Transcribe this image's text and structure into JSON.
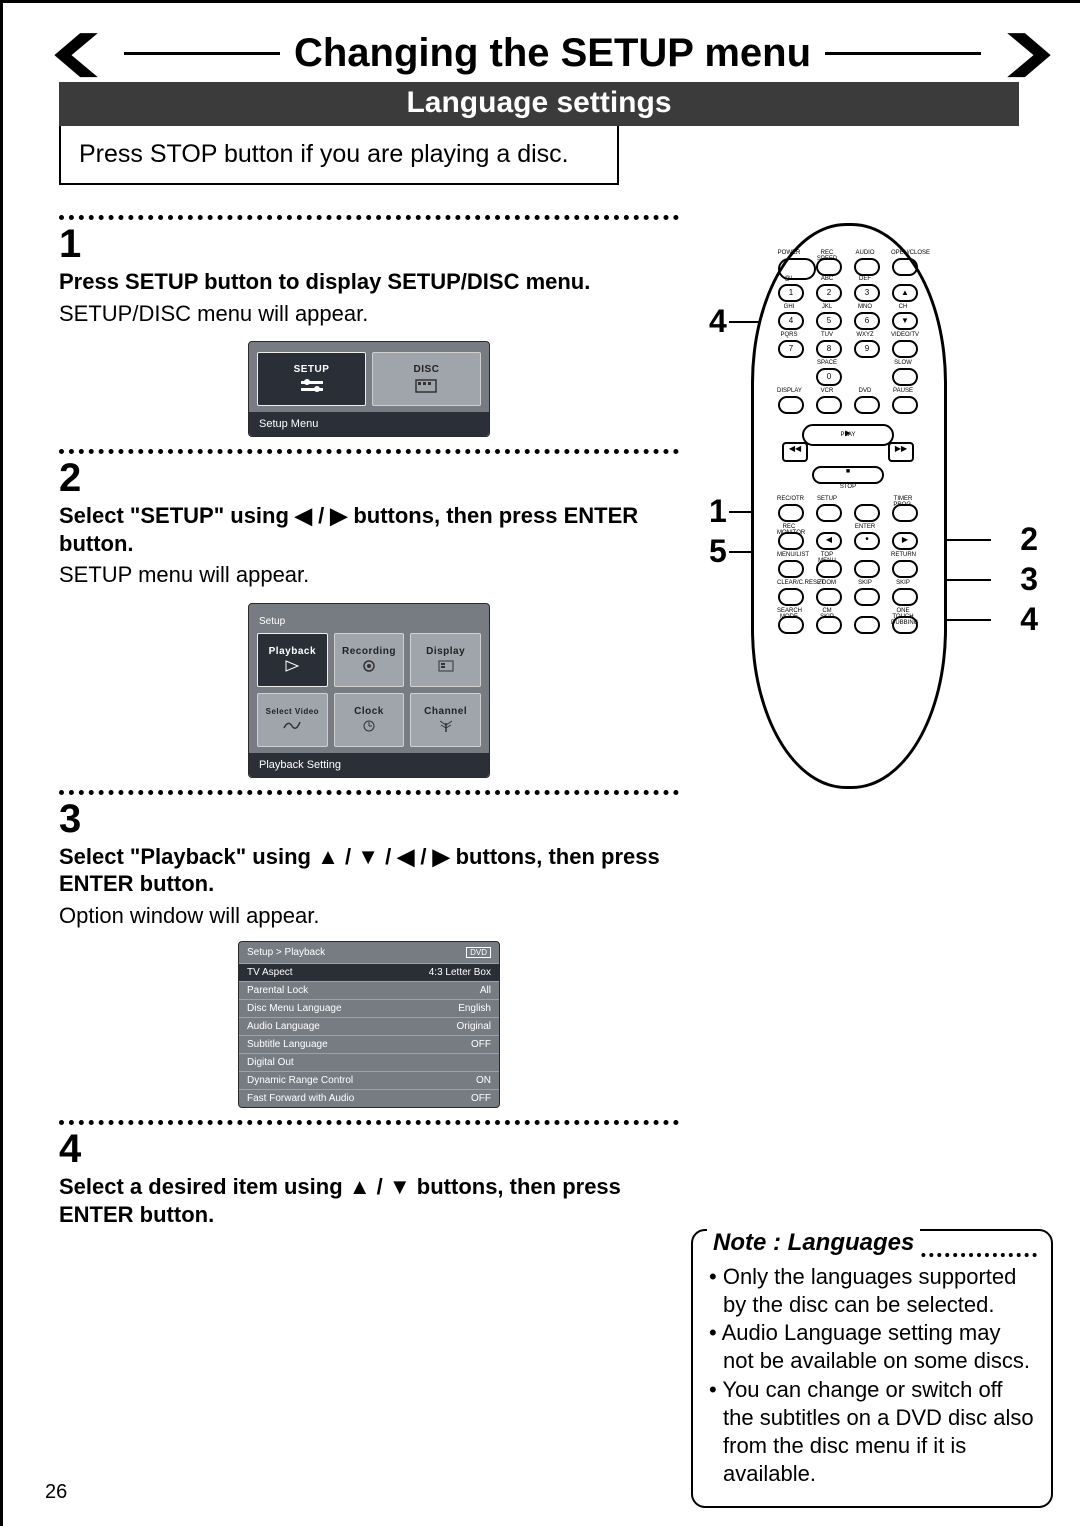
{
  "title": "Changing the SETUP menu",
  "subtitle": "Language settings",
  "intro": "Press STOP button if you are playing a disc.",
  "steps": {
    "s1": {
      "num": "1",
      "heading": "Press SETUP button to display SETUP/DISC menu.",
      "body": "SETUP/DISC menu will appear.",
      "screen": {
        "left_label": "SETUP",
        "right_label": "DISC",
        "bar": "Setup Menu"
      }
    },
    "s2": {
      "num": "2",
      "heading_a": "Select \"SETUP\" using ",
      "heading_b": " buttons, then press ENTER button.",
      "arrows": "◀ / ▶",
      "body": "SETUP menu will appear.",
      "screen": {
        "heading": "Setup",
        "c1": "Playback",
        "c2": "Recording",
        "c3": "Display",
        "c4": "Select Video",
        "c5": "Clock",
        "c6": "Channel",
        "bar": "Playback Setting"
      }
    },
    "s3": {
      "num": "3",
      "heading_a": "Select \"Playback\" using ",
      "heading_b": " buttons, then press ENTER button.",
      "arrows": "▲ / ▼ / ◀ / ▶",
      "body": "Option window will appear.",
      "screen": {
        "breadcrumb": "Setup > Playback",
        "tag": "DVD",
        "rows": [
          {
            "k": "TV Aspect",
            "v": "4:3 Letter Box",
            "sel": true
          },
          {
            "k": "Parental Lock",
            "v": "All"
          },
          {
            "k": "Disc Menu Language",
            "v": "English"
          },
          {
            "k": "Audio Language",
            "v": "Original"
          },
          {
            "k": "Subtitle Language",
            "v": "OFF"
          },
          {
            "k": "Digital Out",
            "v": ""
          },
          {
            "k": "Dynamic Range Control",
            "v": "ON"
          },
          {
            "k": "Fast Forward with Audio",
            "v": "OFF"
          }
        ]
      }
    },
    "s4": {
      "num": "4",
      "heading_a": "Select a desired item using ",
      "heading_b": " buttons, then press ENTER button.",
      "arrows": "▲ / ▼"
    }
  },
  "remote_callouts": {
    "left": [
      "4",
      "1",
      "5"
    ],
    "right": [
      "2",
      "3",
      "4"
    ]
  },
  "remote_labels": {
    "row1": [
      "POWER",
      "REC SPEED",
      "AUDIO",
      "OPEN/CLOSE"
    ],
    "row2a": [
      "@!.",
      "ABC",
      "DEF",
      ""
    ],
    "row2": [
      "1",
      "2",
      "3",
      "▲"
    ],
    "row3a": [
      "GHI",
      "JKL",
      "MNO",
      "CH"
    ],
    "row3": [
      "4",
      "5",
      "6",
      "▼"
    ],
    "row4a": [
      "PQRS",
      "TUV",
      "WXYZ",
      "VIDEO/TV"
    ],
    "row4": [
      "7",
      "8",
      "9",
      ""
    ],
    "row5a": [
      "",
      "SPACE",
      "",
      "SLOW"
    ],
    "row5": [
      "",
      "0",
      "",
      ""
    ],
    "row6a": [
      "DISPLAY",
      "VCR",
      "DVD",
      "PAUSE"
    ],
    "play": "PLAY",
    "stop": "STOP",
    "row8a": [
      "REC/OTR",
      "SETUP",
      "",
      "TIMER PROG."
    ],
    "row9a": [
      "REC MONITOR",
      "",
      "ENTER",
      ""
    ],
    "row10a": [
      "MENU/LIST",
      "TOP MENU",
      "",
      "RETURN"
    ],
    "row11a": [
      "CLEAR/C.RESET",
      "ZOOM",
      "SKIP",
      "SKIP"
    ],
    "row12a": [
      "SEARCH MODE",
      "CM SKIP",
      "",
      "ONE TOUCH DUBBING"
    ]
  },
  "note": {
    "title": "Note : Languages",
    "items": [
      "Only the languages supported by the disc can be selected.",
      "Audio Language setting may not be available on some discs.",
      "You can change or switch off the subtitles on a DVD disc also from the disc menu if it is available."
    ]
  },
  "page_number": "26"
}
